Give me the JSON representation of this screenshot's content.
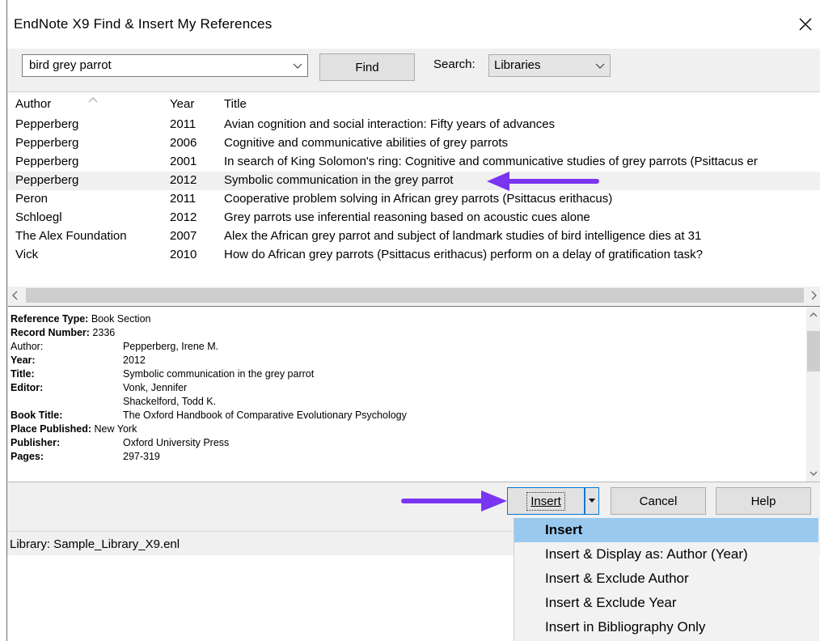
{
  "window": {
    "title": "EndNote X9 Find & Insert My References"
  },
  "search": {
    "query": "bird grey parrot",
    "find_label": "Find",
    "search_label": "Search:",
    "search_scope": "Libraries"
  },
  "columns": {
    "author": "Author",
    "year": "Year",
    "title": "Title"
  },
  "references": [
    {
      "author": "Pepperberg",
      "year": "2011",
      "title": "Avian cognition and social interaction: Fifty years of advances"
    },
    {
      "author": "Pepperberg",
      "year": "2006",
      "title": "Cognitive and communicative abilities of grey parrots"
    },
    {
      "author": "Pepperberg",
      "year": "2001",
      "title": "In search of King Solomon's ring: Cognitive and communicative studies of grey parrots (Psittacus er"
    },
    {
      "author": "Pepperberg",
      "year": "2012",
      "title": "Symbolic communication in the grey parrot"
    },
    {
      "author": "Peron",
      "year": "2011",
      "title": "Cooperative problem solving in African grey parrots (Psittacus erithacus)"
    },
    {
      "author": "Schloegl",
      "year": "2012",
      "title": "Grey parrots use inferential reasoning based on acoustic cues alone"
    },
    {
      "author": "The Alex Foundation",
      "year": "2007",
      "title": "Alex the African grey parrot and subject of landmark studies of bird intelligence dies at 31"
    },
    {
      "author": "Vick",
      "year": "2010",
      "title": "How do African grey parrots (Psittacus erithacus) perform on a delay of gratification task?"
    }
  ],
  "detail": {
    "labels": {
      "ref_type": "Reference Type:",
      "record_number": "Record Number:",
      "author": "Author:",
      "year": "Year:",
      "title": "Title:",
      "editor": "Editor:",
      "book_title": "Book Title:",
      "place": "Place Published:",
      "publisher": "Publisher:",
      "pages": "Pages:"
    },
    "values": {
      "ref_type": "Book Section",
      "record_number": "2336",
      "author": "Pepperberg, Irene M.",
      "year": "2012",
      "title": "Symbolic communication in the grey parrot",
      "editor_1": "Vonk, Jennifer",
      "editor_2": "Shackelford, Todd K.",
      "book_title": "The Oxford Handbook of Comparative Evolutionary Psychology",
      "place": "New York",
      "publisher": "Oxford University Press",
      "pages": "297-319"
    }
  },
  "buttons": {
    "insert": "Insert",
    "cancel": "Cancel",
    "help": "Help"
  },
  "status": "Library: Sample_Library_X9.enl",
  "insert_menu": [
    "Insert",
    "Insert & Display as: Author (Year)",
    "Insert & Exclude Author",
    "Insert & Exclude Year",
    "Insert in Bibliography Only"
  ],
  "colors": {
    "selection": "#f0f0f0",
    "menu_highlight": "#99c9ef",
    "annotation_arrow": "#7a35f0",
    "focus_border": "#0078d7"
  }
}
